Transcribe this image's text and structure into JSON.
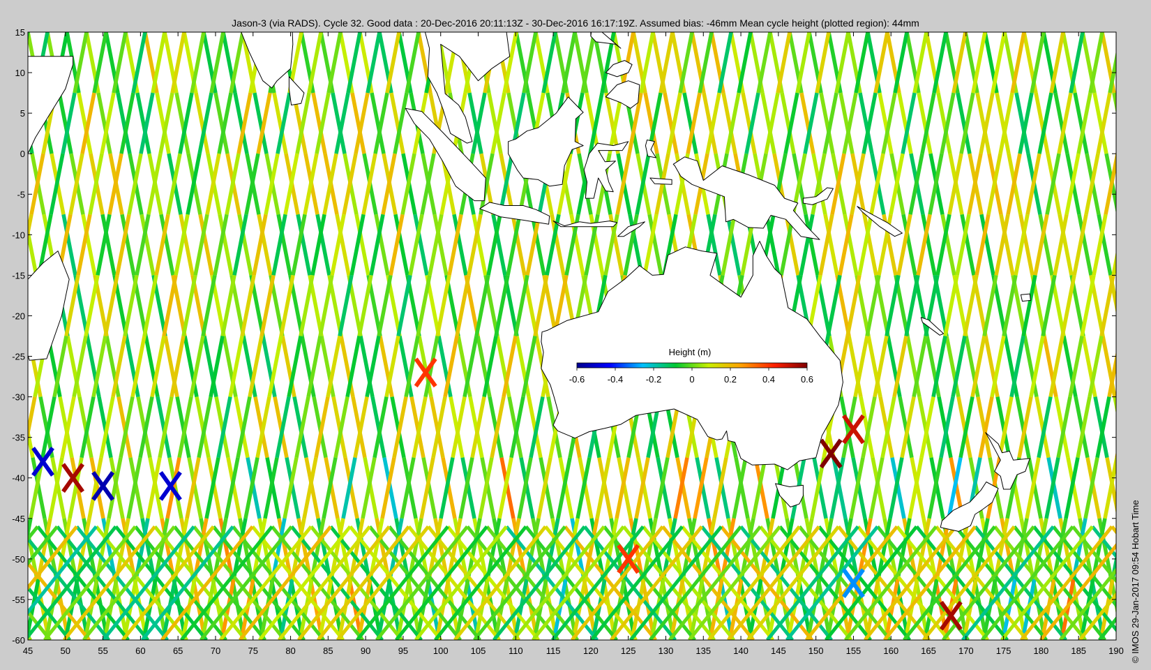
{
  "title": "Jason-3 (via RADS). Cycle 32. Good data : 20-Dec-2016 20:11:13Z - 30-Dec-2016 16:17:19Z. Assumed bias: -46mm  Mean cycle height (plotted region): 44mm",
  "credit": "© IMOS 29-Jan-2017 09:54 Hobart Time",
  "map": {
    "lon_range": [
      45,
      190
    ],
    "lat_range": [
      -60,
      15
    ],
    "lon_ticks": [
      45,
      50,
      55,
      60,
      65,
      70,
      75,
      80,
      85,
      90,
      95,
      100,
      105,
      110,
      115,
      120,
      125,
      130,
      135,
      140,
      145,
      150,
      155,
      160,
      165,
      170,
      175,
      180,
      185,
      190
    ],
    "lat_ticks": [
      15,
      10,
      5,
      0,
      -5,
      -10,
      -15,
      -20,
      -25,
      -30,
      -35,
      -40,
      -45,
      -50,
      -55,
      -60
    ],
    "background_color": "#ffffff",
    "coastline_color": "#000000"
  },
  "colorbar": {
    "title": "Height (m)",
    "range": [
      -0.6,
      0.6
    ],
    "tick_labels": [
      "-0.6",
      "-0.4",
      "-0.2",
      "0",
      "0.2",
      "0.4",
      "0.6"
    ],
    "colors": [
      "#00008f",
      "#0000ff",
      "#00bfff",
      "#00c832",
      "#c8f000",
      "#ffa000",
      "#ff2000",
      "#800000"
    ]
  },
  "chart_data": {
    "type": "heatmap",
    "title": "Jason-3 (via RADS). Cycle 32. Good data : 20-Dec-2016 20:11:13Z - 30-Dec-2016 16:17:19Z. Assumed bias: -46mm  Mean cycle height (plotted region): 44mm",
    "xlabel": "",
    "ylabel": "",
    "xlim": [
      45,
      190
    ],
    "ylim": [
      -60,
      15
    ],
    "colorbar_label": "Height (m)",
    "color_range": [
      -0.6,
      0.6
    ],
    "mean_cycle_height_mm": 44,
    "assumed_bias_mm": -46,
    "cycle": 32,
    "anomalies": [
      {
        "lon": 47,
        "lat": -38,
        "value": -0.5
      },
      {
        "lon": 51,
        "lat": -40,
        "value": 0.55
      },
      {
        "lon": 55,
        "lat": -41,
        "value": -0.55
      },
      {
        "lon": 64,
        "lat": -41,
        "value": -0.5
      },
      {
        "lon": 98,
        "lat": -27,
        "value": 0.4
      },
      {
        "lon": 152,
        "lat": -37,
        "value": 0.6
      },
      {
        "lon": 155,
        "lat": -34,
        "value": 0.5
      },
      {
        "lon": 168,
        "lat": -57,
        "value": 0.55
      },
      {
        "lon": 125,
        "lat": -50,
        "value": 0.4
      },
      {
        "lon": 155,
        "lat": -53,
        "value": -0.3
      }
    ]
  }
}
